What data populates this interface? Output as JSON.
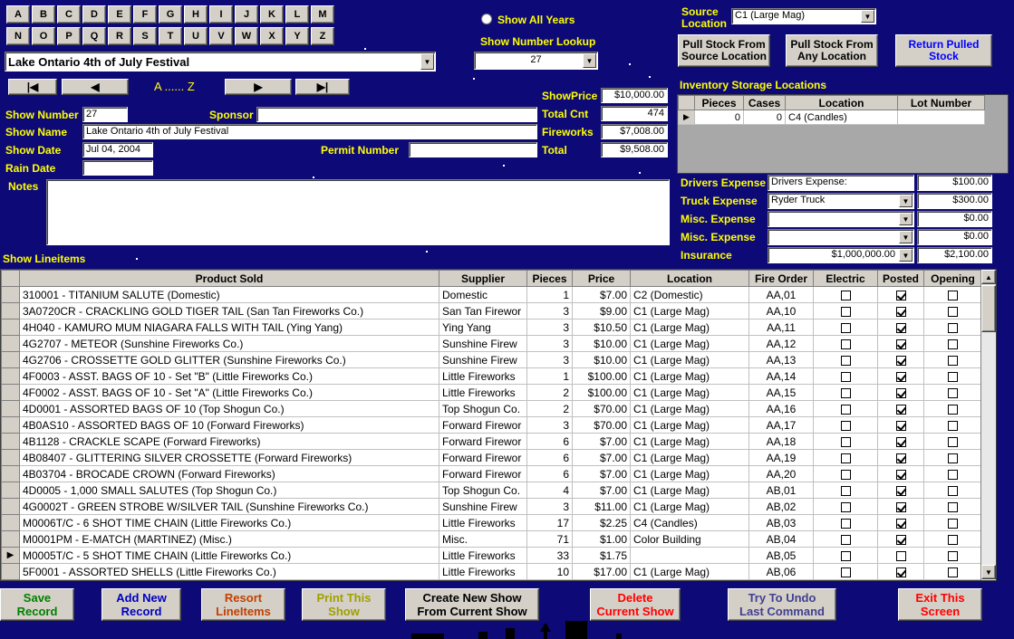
{
  "letters_row1": [
    "A",
    "B",
    "C",
    "D",
    "E",
    "F",
    "G",
    "H",
    "I",
    "J",
    "K",
    "L",
    "M"
  ],
  "letters_row2": [
    "N",
    "O",
    "P",
    "Q",
    "R",
    "S",
    "T",
    "U",
    "V",
    "W",
    "X",
    "Y",
    "Z"
  ],
  "show_selector": {
    "value": "Lake Ontario 4th of July Festival"
  },
  "nav": {
    "first": "|◀",
    "prev": "◀",
    "range": "A ...... Z",
    "next": "▶",
    "last": "▶|"
  },
  "show_all_years": {
    "label": "Show All Years",
    "checked": false
  },
  "show_number_lookup": {
    "label": "Show Number Lookup",
    "value": "27"
  },
  "source_location": {
    "label": "Source\nLocation",
    "value": "C1 (Large Mag)"
  },
  "buttons_top": {
    "pull_source": "Pull Stock From\nSource Location",
    "pull_any": "Pull Stock From\nAny Location",
    "return_pulled": "Return Pulled\nStock"
  },
  "inventory": {
    "title": "Inventory Storage Locations",
    "headers": [
      "Pieces",
      "Cases",
      "Location",
      "Lot Number"
    ],
    "rows": [
      [
        "0",
        "0",
        "C4 (Candles)",
        ""
      ]
    ]
  },
  "form": {
    "show_number_label": "Show Number",
    "show_number": "27",
    "sponsor_label": "Sponsor",
    "sponsor": "",
    "show_name_label": "Show Name",
    "show_name": "Lake Ontario 4th of July Festival",
    "show_date_label": "Show Date",
    "show_date": "Jul 04, 2004",
    "permit_label": "Permit Number",
    "permit": "",
    "rain_date_label": "Rain Date",
    "rain_date": "",
    "notes_label": "Notes",
    "notes": "",
    "lineitems_label": "Show Lineitems"
  },
  "totals": {
    "show_price_label": "ShowPrice",
    "show_price": "$10,000.00",
    "total_cnt_label": "Total Cnt",
    "total_cnt": "474",
    "fireworks_label": "Fireworks",
    "fireworks": "$7,008.00",
    "total_label": "Total",
    "total": "$9,508.00"
  },
  "expenses": {
    "drivers_label": "Drivers Expense",
    "drivers_text": "Drivers Expense:",
    "drivers_amt": "$100.00",
    "truck_label": "Truck Expense",
    "truck_text": "Ryder Truck",
    "truck_amt": "$300.00",
    "misc1_label": "Misc. Expense",
    "misc1_text": "",
    "misc1_amt": "$0.00",
    "misc2_label": "Misc. Expense",
    "misc2_text": "",
    "misc2_amt": "$0.00",
    "insurance_label": "Insurance",
    "insurance_text": "$1,000,000.00",
    "insurance_amt": "$2,100.00"
  },
  "grid": {
    "headers": [
      "Product Sold",
      "Supplier",
      "Pieces",
      "Price",
      "Location",
      "Fire Order",
      "Electric",
      "Posted",
      "Opening"
    ],
    "rows": [
      {
        "product": "310001 -  TITANIUM SALUTE (Domestic)",
        "supplier": "Domestic",
        "pieces": "1",
        "price": "$7.00",
        "location": "C2 (Domestic)",
        "fire": "AA,01",
        "electric": false,
        "posted": true,
        "opening": false,
        "current": false
      },
      {
        "product": "3A0720CR -  CRACKLING GOLD TIGER TAIL (San Tan Fireworks Co.)",
        "supplier": "San Tan Firewor",
        "pieces": "3",
        "price": "$9.00",
        "location": "C1 (Large Mag)",
        "fire": "AA,10",
        "electric": false,
        "posted": true,
        "opening": false,
        "current": false
      },
      {
        "product": "4H040 -  KAMURO MUM NIAGARA FALLS WITH TAIL (Ying Yang)",
        "supplier": "Ying Yang",
        "pieces": "3",
        "price": "$10.50",
        "location": "C1 (Large Mag)",
        "fire": "AA,11",
        "electric": false,
        "posted": true,
        "opening": false,
        "current": false
      },
      {
        "product": "4G2707 -  METEOR (Sunshine Fireworks Co.)",
        "supplier": "Sunshine Firew",
        "pieces": "3",
        "price": "$10.00",
        "location": "C1 (Large Mag)",
        "fire": "AA,12",
        "electric": false,
        "posted": true,
        "opening": false,
        "current": false
      },
      {
        "product": "4G2706 -  CROSSETTE GOLD GLITTER (Sunshine Fireworks Co.)",
        "supplier": "Sunshine Firew",
        "pieces": "3",
        "price": "$10.00",
        "location": "C1 (Large Mag)",
        "fire": "AA,13",
        "electric": false,
        "posted": true,
        "opening": false,
        "current": false
      },
      {
        "product": "4F0003 -  ASST. BAGS OF 10 - Set \"B\" (Little Fireworks Co.)",
        "supplier": "Little Fireworks",
        "pieces": "1",
        "price": "$100.00",
        "location": "C1 (Large Mag)",
        "fire": "AA,14",
        "electric": false,
        "posted": true,
        "opening": false,
        "current": false
      },
      {
        "product": "4F0002 -  ASST. BAGS OF 10 - Set \"A\" (Little Fireworks Co.)",
        "supplier": "Little Fireworks",
        "pieces": "2",
        "price": "$100.00",
        "location": "C1 (Large Mag)",
        "fire": "AA,15",
        "electric": false,
        "posted": true,
        "opening": false,
        "current": false
      },
      {
        "product": "4D0001 -  ASSORTED BAGS OF 10 (Top Shogun Co.)",
        "supplier": "Top Shogun Co.",
        "pieces": "2",
        "price": "$70.00",
        "location": "C1 (Large Mag)",
        "fire": "AA,16",
        "electric": false,
        "posted": true,
        "opening": false,
        "current": false
      },
      {
        "product": "4B0AS10 -  ASSORTED BAGS OF 10 (Forward Fireworks)",
        "supplier": "Forward Firewor",
        "pieces": "3",
        "price": "$70.00",
        "location": "C1 (Large Mag)",
        "fire": "AA,17",
        "electric": false,
        "posted": true,
        "opening": false,
        "current": false
      },
      {
        "product": "4B1128 -  CRACKLE SCAPE (Forward Fireworks)",
        "supplier": "Forward Firewor",
        "pieces": "6",
        "price": "$7.00",
        "location": "C1 (Large Mag)",
        "fire": "AA,18",
        "electric": false,
        "posted": true,
        "opening": false,
        "current": false
      },
      {
        "product": "4B08407 -  GLITTERING SILVER CROSSETTE (Forward Fireworks)",
        "supplier": "Forward Firewor",
        "pieces": "6",
        "price": "$7.00",
        "location": "C1 (Large Mag)",
        "fire": "AA,19",
        "electric": false,
        "posted": true,
        "opening": false,
        "current": false
      },
      {
        "product": "4B03704 -  BROCADE CROWN (Forward Fireworks)",
        "supplier": "Forward Firewor",
        "pieces": "6",
        "price": "$7.00",
        "location": "C1 (Large Mag)",
        "fire": "AA,20",
        "electric": false,
        "posted": true,
        "opening": false,
        "current": false
      },
      {
        "product": "4D0005 -  1,000 SMALL SALUTES (Top Shogun Co.)",
        "supplier": "Top Shogun Co.",
        "pieces": "4",
        "price": "$7.00",
        "location": "C1 (Large Mag)",
        "fire": "AB,01",
        "electric": false,
        "posted": true,
        "opening": false,
        "current": false
      },
      {
        "product": "4G0002T -  GREEN STROBE W/SILVER TAIL (Sunshine Fireworks Co.)",
        "supplier": "Sunshine Firew",
        "pieces": "3",
        "price": "$11.00",
        "location": "C1 (Large Mag)",
        "fire": "AB,02",
        "electric": false,
        "posted": true,
        "opening": false,
        "current": false
      },
      {
        "product": "M0006T/C -  6 SHOT TIME CHAIN (Little Fireworks Co.)",
        "supplier": "Little Fireworks",
        "pieces": "17",
        "price": "$2.25",
        "location": "C4 (Candles)",
        "fire": "AB,03",
        "electric": false,
        "posted": true,
        "opening": false,
        "current": false
      },
      {
        "product": "M0001PM -  E-MATCH (MARTINEZ) (Misc.)",
        "supplier": "Misc.",
        "pieces": "71",
        "price": "$1.00",
        "location": "Color Building",
        "fire": "AB,04",
        "electric": false,
        "posted": true,
        "opening": false,
        "current": false
      },
      {
        "product": "M0005T/C -  5 SHOT TIME CHAIN (Little Fireworks Co.)",
        "supplier": "Little Fireworks",
        "pieces": "33",
        "price": "$1.75",
        "location": "",
        "fire": "AB,05",
        "electric": false,
        "posted": false,
        "opening": false,
        "current": true
      },
      {
        "product": "5F0001 -  ASSORTED SHELLS (Little Fireworks Co.)",
        "supplier": "Little Fireworks",
        "pieces": "10",
        "price": "$17.00",
        "location": "C1 (Large Mag)",
        "fire": "AB,06",
        "electric": false,
        "posted": true,
        "opening": false,
        "current": false
      }
    ]
  },
  "bottom_buttons": {
    "save": {
      "label": "Save\nRecord",
      "color": "#008000"
    },
    "add": {
      "label": "Add New\nRecord",
      "color": "#0000c0"
    },
    "resort": {
      "label": "Resort\nLineItems",
      "color": "#c04000"
    },
    "print": {
      "label": "Print This\nShow",
      "color": "#a0a000"
    },
    "create": {
      "label": "Create New Show\nFrom Current Show",
      "color": "#000000"
    },
    "delete": {
      "label": "Delete\nCurrent Show",
      "color": "#ff0000"
    },
    "undo": {
      "label": "Try To Undo\nLast Command",
      "color": "#404090"
    },
    "exit": {
      "label": "Exit This\nScreen",
      "color": "#ff0000"
    }
  }
}
